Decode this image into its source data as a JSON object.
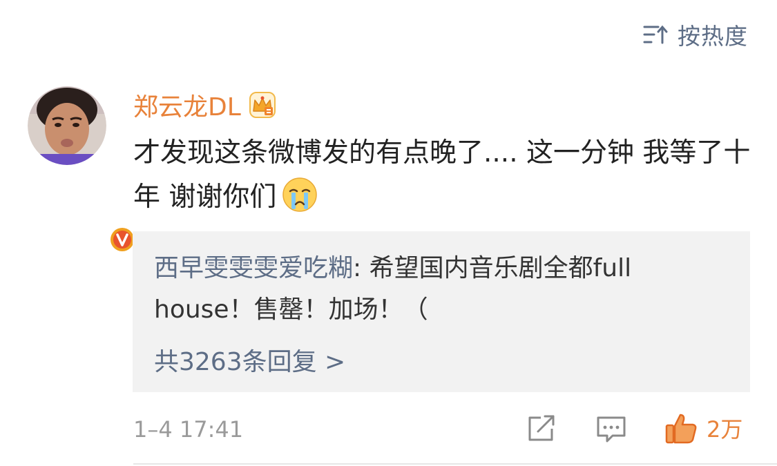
{
  "sort": {
    "label": "按热度",
    "icon": "sort-icon"
  },
  "comment": {
    "username": "郑云龙DL",
    "username_color": "#e8823a",
    "badge_icon": "crown-icon",
    "verified_icon": "verified-v-icon",
    "text": "才发现这条微博发的有点晚了.... 这一分钟 我等了十年 谢谢你们",
    "emoji_icon": "crying-face-icon"
  },
  "reply": {
    "user": "西早雯雯雯爱吃糊",
    "separator": ": ",
    "text": "希望国内音乐剧全都full house！售罄！加场！（",
    "more_label": "共3263条回复 >",
    "link_color": "#5d6d86"
  },
  "footer": {
    "timestamp": "1–4 17:41",
    "share_icon": "share-icon",
    "comment_icon": "comment-icon",
    "like_icon": "thumbs-up-icon",
    "like_count": "2万"
  }
}
